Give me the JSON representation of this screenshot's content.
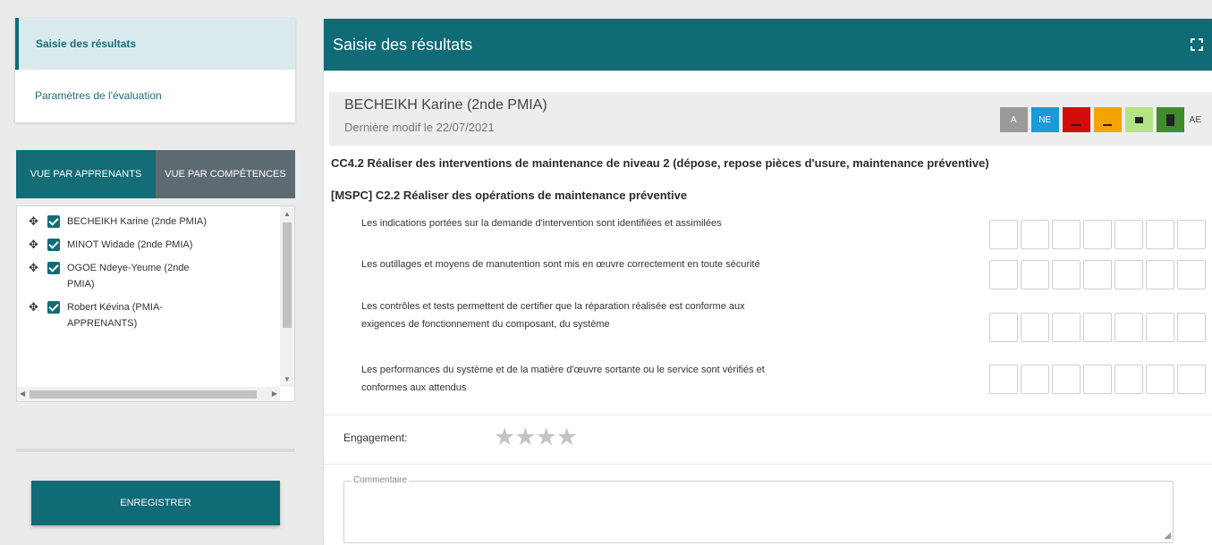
{
  "menu": {
    "items": [
      {
        "label": "Saisie des résultats",
        "active": true
      },
      {
        "label": "Paramètres de l'évaluation",
        "active": false
      }
    ]
  },
  "view_toggle": {
    "options": [
      {
        "label": "VUE PAR APPRENANTS",
        "active": true
      },
      {
        "label": "VUE PAR COMPÉTENCES",
        "active": false
      }
    ]
  },
  "learners": [
    {
      "name": "BECHEIKH Karine (2nde PMIA)",
      "checked": true
    },
    {
      "name": "MINOT Widade (2nde PMIA)",
      "checked": true
    },
    {
      "name": "OGOE Ndeye-Yeume (2nde PMIA)",
      "checked": true
    },
    {
      "name": "Robert Kévina (PMIA-APPRENANTS)",
      "checked": true
    }
  ],
  "save_button": "ENREGISTRER",
  "panel": {
    "title": "Saisie des résultats",
    "icons": {
      "expand": "expand-icon"
    }
  },
  "student": {
    "name": "BECHEIKH Karine (2nde PMIA)",
    "last_modified": "Dernière modif le 22/07/2021"
  },
  "legend": {
    "labels": [
      "A",
      "NE",
      "AE"
    ],
    "colors": {
      "A": "#9a9a9a",
      "NE": "#1b9ad8",
      "red": "#d40b0b",
      "orange": "#f5a300",
      "light_green": "#b3e487",
      "green": "#3e8c2b"
    }
  },
  "competency": {
    "title": "CC4.2 Réaliser des interventions de maintenance de niveau 2 (dépose, repose pièces d'usure, maintenance préventive)",
    "subtitle": "[MSPC] C2.2 Réaliser des opérations de maintenance préventive",
    "criteria": [
      {
        "text": "Les indications portées sur la demande d'intervention sont identifiées et assimilées"
      },
      {
        "text": "Les outillages et moyens de manutention sont mis en œuvre correctement en toute sécurité"
      },
      {
        "text": "Les contrôles et tests permettent de certifier que la réparation réalisée est conforme aux exigences de fonctionnement du composant, du système"
      },
      {
        "text": "Les performances du système et de la matière d'œuvre sortante ou le service sont vérifiés et conformes aux attendus"
      }
    ]
  },
  "engagement": {
    "label": "Engagement:",
    "rating": 0,
    "max": 4
  },
  "comment": {
    "label": "Commentaire",
    "value": ""
  }
}
